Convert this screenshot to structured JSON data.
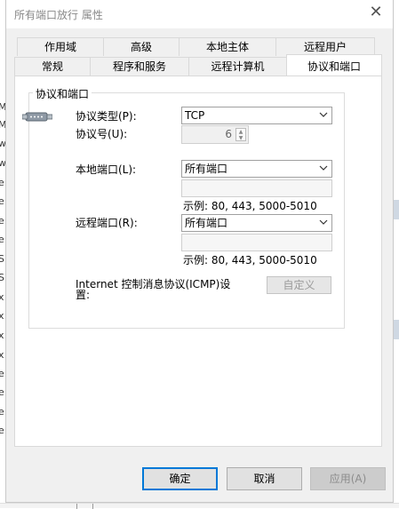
{
  "window": {
    "title": "所有端口放行 属性"
  },
  "tabs_back": [
    "作用域",
    "高级",
    "本地主体",
    "远程用户"
  ],
  "tabs_front": [
    "常规",
    "程序和服务",
    "远程计算机",
    "协议和端口"
  ],
  "group": {
    "title": "协议和端口",
    "protocol_type_label": "协议类型(P):",
    "protocol_type_value": "TCP",
    "protocol_number_label": "协议号(U):",
    "protocol_number_value": "6",
    "local_port_label": "本地端口(L):",
    "local_port_value": "所有端口",
    "local_example": "示例: 80, 443, 5000-5010",
    "remote_port_label": "远程端口(R):",
    "remote_port_value": "所有端口",
    "remote_example": "示例: 80, 443, 5000-5010",
    "icmp_label_line1": "Internet 控制消息协议(ICMP)设",
    "icmp_label_line2": "置:",
    "customize_button": "自定义"
  },
  "buttons": {
    "ok": "确定",
    "cancel": "取消",
    "apply": "应用(A)"
  },
  "background_letters": [
    "M",
    "M",
    "w",
    "w",
    "e",
    "e",
    "e",
    "e",
    "S",
    "S",
    "x",
    "x",
    "x",
    "x",
    "e",
    "e",
    "e",
    "e"
  ]
}
